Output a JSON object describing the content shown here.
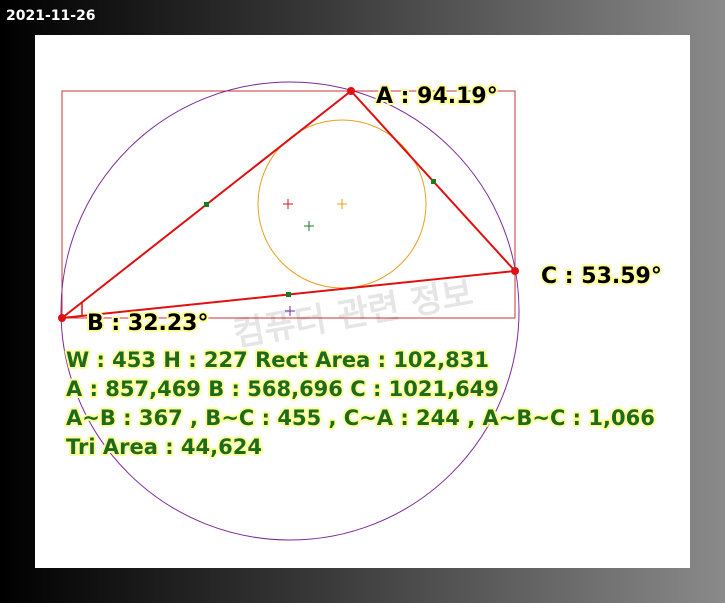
{
  "header": {
    "date": "2021-11-26"
  },
  "labels": {
    "angle_a": "A : 94.19°",
    "angle_b": "B : 32.23°",
    "angle_c": "C : 53.59°"
  },
  "stats": {
    "line1": "W : 453 H : 227 Rect Area : 102,831",
    "line2": "A : 857,469 B : 568,696 C : 1021,649",
    "line3": "A~B : 367 , B~C : 455 , C~A : 244 , A~B~C : 1,066",
    "line4": "Tri Area : 44,624"
  },
  "watermark": {
    "text": "컴퓨터 관련 정보"
  },
  "colors": {
    "rect": "#cc3333",
    "triangle": "#e01010",
    "circumcircle": "#7a2a9a",
    "incircle": "#e8a020",
    "midpoint": "#1e7a1e"
  }
}
